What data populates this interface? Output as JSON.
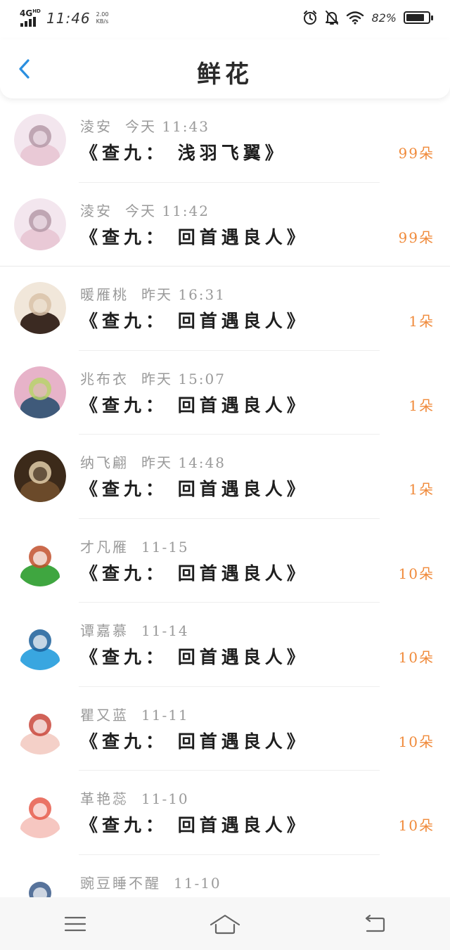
{
  "status_bar": {
    "network": "4G",
    "network_sup": "HD",
    "time": "11:46",
    "speed_value": "2.00",
    "speed_unit": "KB/s",
    "battery_percent": "82%",
    "battery_level": 0.82
  },
  "header": {
    "title": "鲜花",
    "back_icon": "chevron-left-icon"
  },
  "items": [
    {
      "name": "淩安",
      "time": "今天 11:43",
      "gift": "《查九： 浅羽飞翼》",
      "count": "99朵",
      "avatar_colors": [
        "#e9c9d6",
        "#b59aa8",
        "#f3e6ee"
      ]
    },
    {
      "name": "淩安",
      "time": "今天 11:42",
      "gift": "《查九： 回首遇良人》",
      "count": "99朵",
      "avatar_colors": [
        "#e9c9d6",
        "#b59aa8",
        "#f3e6ee"
      ]
    },
    {
      "name": "暖雁桃",
      "time": "昨天 16:31",
      "gift": "《查九： 回首遇良人》",
      "count": "1朵",
      "avatar_colors": [
        "#3b2a22",
        "#d9c2a8",
        "#f1e7da"
      ]
    },
    {
      "name": "兆布衣",
      "time": "昨天 15:07",
      "gift": "《查九： 回首遇良人》",
      "count": "1朵",
      "avatar_colors": [
        "#3f5a7a",
        "#b7d36b",
        "#e7b3c9"
      ]
    },
    {
      "name": "纳飞翩",
      "time": "昨天 14:48",
      "gift": "《查九： 回首遇良人》",
      "count": "1朵",
      "avatar_colors": [
        "#6b4a2a",
        "#e0cda9",
        "#3c2a1a"
      ]
    },
    {
      "name": "才凡雁",
      "time": "11-15",
      "gift": "《查九： 回首遇良人》",
      "count": "10朵",
      "avatar_colors": [
        "#3fa640",
        "#c2502d",
        "#ffffff"
      ]
    },
    {
      "name": "谭嘉慕",
      "time": "11-14",
      "gift": "《查九： 回首遇良人》",
      "count": "10朵",
      "avatar_colors": [
        "#39a6e0",
        "#1b5f9a",
        "#ffffff"
      ]
    },
    {
      "name": "瞿又蓝",
      "time": "11-11",
      "gift": "《查九： 回首遇良人》",
      "count": "10朵",
      "avatar_colors": [
        "#f4d0c8",
        "#c9463b",
        "#ffffff"
      ]
    },
    {
      "name": "革艳蕊",
      "time": "11-10",
      "gift": "《查九： 回首遇良人》",
      "count": "10朵",
      "avatar_colors": [
        "#f6c7c1",
        "#e65b4a",
        "#ffffff"
      ]
    },
    {
      "name": "豌豆睡不醒",
      "time": "11-10",
      "gift": "",
      "count": "",
      "avatar_colors": [
        "#dfe7f2",
        "#3a5a8a",
        "#ffffff"
      ]
    }
  ],
  "bottom_nav": {
    "menu_icon": "menu-icon",
    "home_icon": "home-icon",
    "back_icon": "back-icon"
  },
  "colors": {
    "accent_count": "#f08a3a",
    "back_arrow": "#2a8fe0",
    "nav_bar_bg": "#f7f7f7"
  }
}
